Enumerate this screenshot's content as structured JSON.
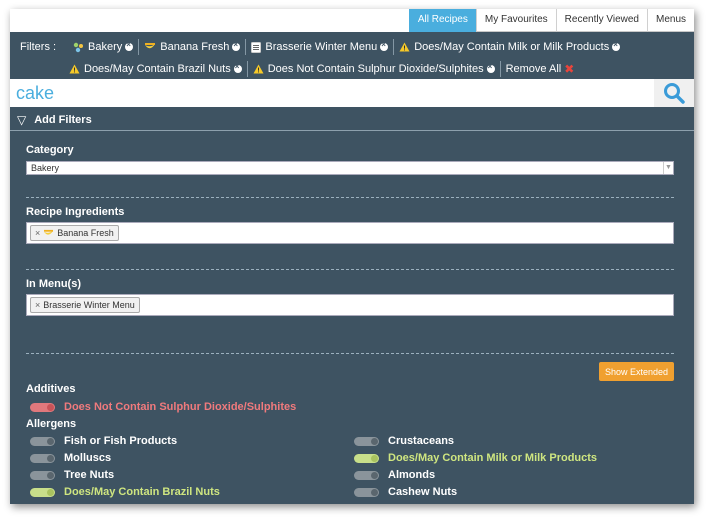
{
  "tabs": [
    {
      "label": "All Recipes",
      "active": true
    },
    {
      "label": "My Favourites",
      "active": false
    },
    {
      "label": "Recently Viewed",
      "active": false
    },
    {
      "label": "Menus",
      "active": false
    }
  ],
  "filters": {
    "label": "Filters :",
    "row1": [
      {
        "label": "Bakery",
        "icon": "bakery-icon"
      },
      {
        "label": "Banana Fresh",
        "icon": "banana-icon"
      },
      {
        "label": "Brasserie Winter Menu",
        "icon": "menu-icon"
      },
      {
        "label": "Does/May Contain Milk or Milk Products",
        "icon": "warning-icon"
      }
    ],
    "row2": [
      {
        "label": "Does/May Contain Brazil Nuts",
        "icon": "warning-icon"
      },
      {
        "label": "Does Not Contain Sulphur Dioxide/Sulphites",
        "icon": "warning-icon"
      }
    ],
    "remove_all": "Remove All"
  },
  "search": {
    "value": "cake"
  },
  "add_filters": "Add Filters",
  "category": {
    "title": "Category",
    "value": "Bakery"
  },
  "ingredients": {
    "title": "Recipe Ingredients",
    "tags": [
      "Banana Fresh"
    ]
  },
  "menus": {
    "title": "In Menu(s)",
    "tags": [
      "Brasserie Winter Menu"
    ]
  },
  "show_extended": "Show Extended",
  "additives": {
    "title": "Additives",
    "items": [
      {
        "label": "Does Not Contain Sulphur Dioxide/Sulphites",
        "state": "on-red"
      }
    ]
  },
  "allergens": {
    "title": "Allergens",
    "left": [
      {
        "label": "Fish or Fish Products",
        "state": "off"
      },
      {
        "label": "Molluscs",
        "state": "off"
      },
      {
        "label": "Tree Nuts",
        "state": "off"
      },
      {
        "label": "Does/May Contain Brazil Nuts",
        "state": "on-green"
      }
    ],
    "right": [
      {
        "label": "Crustaceans",
        "state": "off"
      },
      {
        "label": "Does/May Contain Milk or Milk Products",
        "state": "on-green"
      },
      {
        "label": "Almonds",
        "state": "off"
      },
      {
        "label": "Cashew Nuts",
        "state": "off"
      }
    ]
  },
  "colors": {
    "panel": "#3e5362",
    "accent": "#4aaede",
    "button": "#f0a030"
  }
}
